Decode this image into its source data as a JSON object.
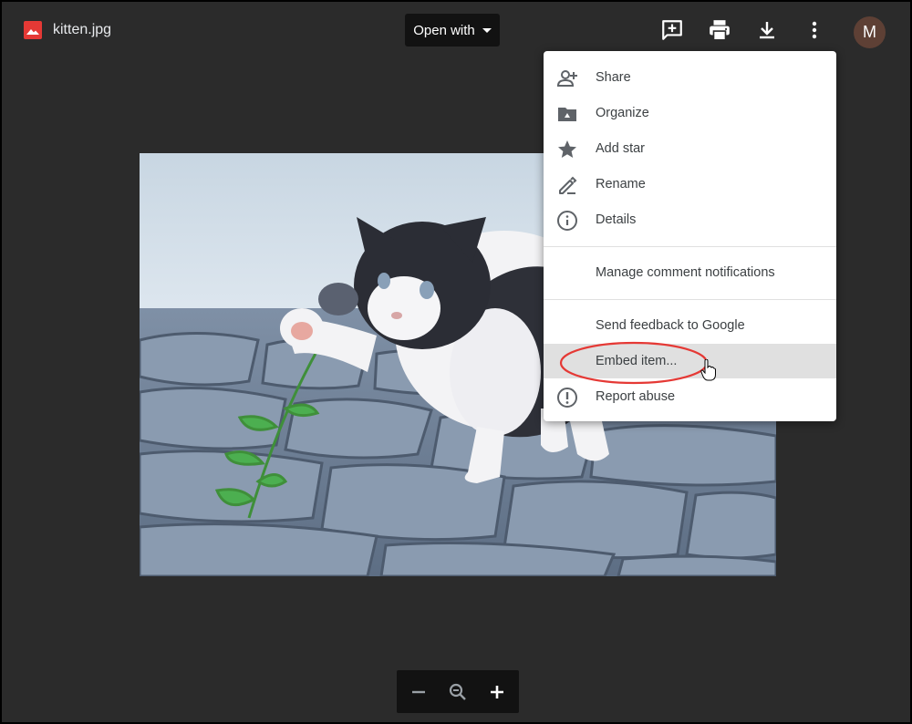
{
  "file": {
    "name": "kitten.jpg",
    "icon": "image-file-icon",
    "icon_color": "#e53935"
  },
  "toolbar": {
    "open_with_label": "Open with",
    "tools": [
      {
        "name": "add-comment-icon"
      },
      {
        "name": "print-icon"
      },
      {
        "name": "download-icon"
      },
      {
        "name": "more-options-icon"
      }
    ],
    "avatar_initial": "M",
    "avatar_color": "#5e4035"
  },
  "image": {
    "description_name": "kitten-photo"
  },
  "menu": {
    "items": [
      {
        "label": "Share",
        "icon": "add-person-icon"
      },
      {
        "label": "Organize",
        "icon": "drive-folder-icon"
      },
      {
        "label": "Add star",
        "icon": "star-icon"
      },
      {
        "label": "Rename",
        "icon": "pencil-icon"
      },
      {
        "label": "Details",
        "icon": "info-icon"
      },
      {
        "label": "Manage comment notifications",
        "icon": ""
      },
      {
        "label": "Send feedback to Google",
        "icon": ""
      },
      {
        "label": "Embed item...",
        "icon": ""
      },
      {
        "label": "Report abuse",
        "icon": "report-icon"
      }
    ],
    "highlighted": "Embed item...",
    "highlight_color": "#e53935"
  },
  "zoom": {
    "controls": [
      "zoom-out-icon",
      "zoom-reset-icon",
      "zoom-in-icon"
    ]
  }
}
